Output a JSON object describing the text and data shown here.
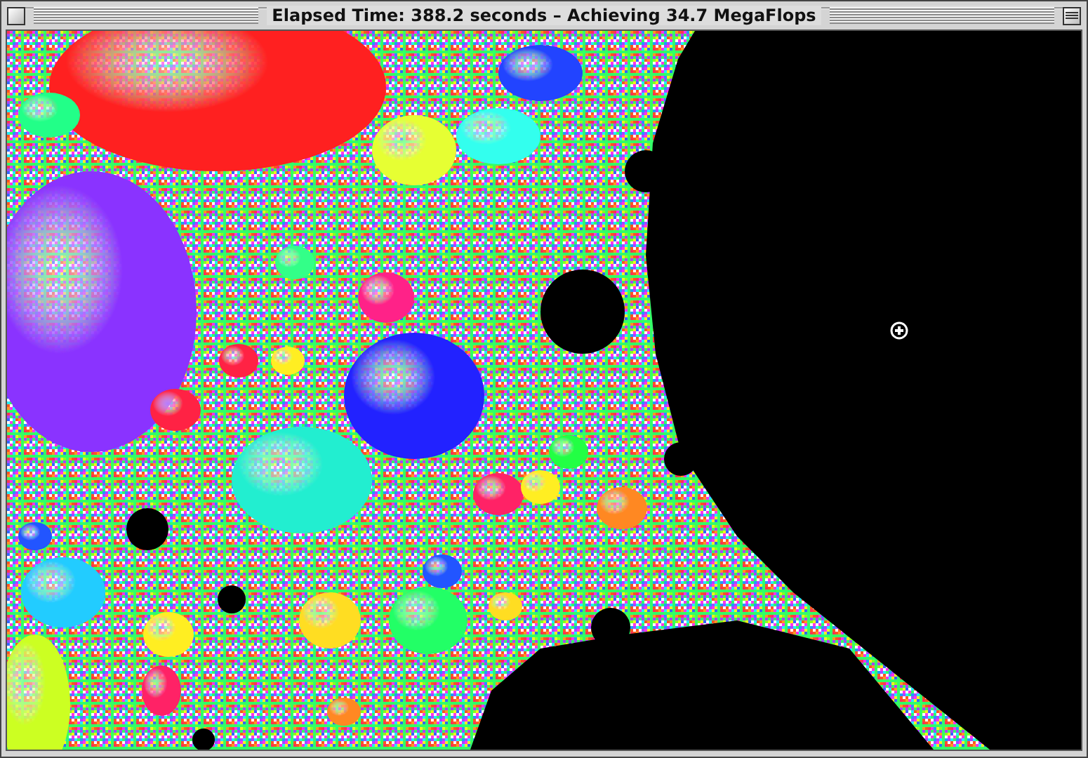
{
  "window": {
    "title": "Elapsed Time: 388.2 seconds – Achieving 34.7 MegaFlops"
  }
}
